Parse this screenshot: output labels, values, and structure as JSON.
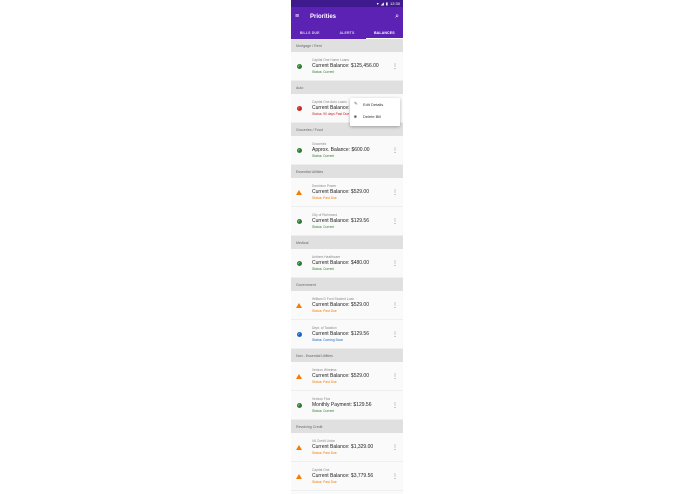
{
  "statusbar": {
    "time": "12:30",
    "icons": [
      "wifi-icon",
      "signal-icon",
      "battery-icon"
    ]
  },
  "appbar": {
    "title": "Priorities",
    "menu_icon": "menu-icon",
    "search_icon": "search-icon"
  },
  "tabs": [
    {
      "label": "BILLS DUE"
    },
    {
      "label": "ALERTS"
    },
    {
      "label": "BALANCES"
    }
  ],
  "sections": [
    {
      "title": "Mortgage / Rent",
      "items": [
        {
          "creditor": "Capital One Home Loans",
          "balance": "Current Balance: $125,456.00",
          "status": "Status: Current",
          "kind": "ok"
        }
      ]
    },
    {
      "title": "Auto",
      "items": [
        {
          "creditor": "Capital One Auto Loans",
          "balance": "Current Balance: $14,000.00",
          "status": "Status: 90 days Past Due",
          "kind": "error"
        }
      ]
    },
    {
      "title": "Groceries / Food",
      "items": [
        {
          "creditor": "Groceries",
          "balance": "Approx. Balance: $600.00",
          "status": "Status: Current",
          "kind": "ok"
        }
      ]
    },
    {
      "title": "Essential Utilities",
      "items": [
        {
          "creditor": "Dominion Power",
          "balance": "Current Balance: $529.00",
          "status": "Status: Past Due",
          "kind": "warn"
        },
        {
          "creditor": "City of Richmond",
          "balance": "Current Balance: $129.56",
          "status": "Status: Current",
          "kind": "ok"
        }
      ]
    },
    {
      "title": "Medical",
      "items": [
        {
          "creditor": "Anthem Healthcare",
          "balance": "Current Balance: $480.00",
          "status": "Status: Current",
          "kind": "ok"
        }
      ]
    },
    {
      "title": "Government",
      "items": [
        {
          "creditor": "William D Ford Student Loan",
          "balance": "Current Balance: $529.00",
          "status": "Status: Past Due",
          "kind": "warn"
        },
        {
          "creditor": "Dept. of Taxation",
          "balance": "Current Balance: $129.56",
          "status": "Status: Coming Soon",
          "kind": "info"
        }
      ]
    },
    {
      "title": "Non - Essential Utilities",
      "items": [
        {
          "creditor": "Verizon Wireless",
          "balance": "Current Balance: $529.00",
          "status": "Status: Past Due",
          "kind": "warn"
        },
        {
          "creditor": "Verizon Fios",
          "balance": "Monthly Payment: $129.56",
          "status": "Status: Current",
          "kind": "ok"
        }
      ]
    },
    {
      "title": "Revolving Credit",
      "items": [
        {
          "creditor": "VA Credit Union",
          "balance": "Current Balance: $1,329.00",
          "status": "Status: Past Due",
          "kind": "warn"
        },
        {
          "creditor": "Capital One",
          "balance": "Current Balance: $3,779.56",
          "status": "Status: Past Due",
          "kind": "warn"
        }
      ]
    }
  ],
  "popup_menu": {
    "options": [
      {
        "label": "Edit Details",
        "icon": "pencil-icon"
      },
      {
        "label": "Delete Bill",
        "icon": "trash-icon"
      }
    ]
  },
  "colors": {
    "appbar": "#5b22b3",
    "statusbar": "#3f1a8f",
    "ok": "#2e7d32",
    "warn": "#f57c00",
    "error": "#c62828",
    "info": "#1565c0"
  }
}
